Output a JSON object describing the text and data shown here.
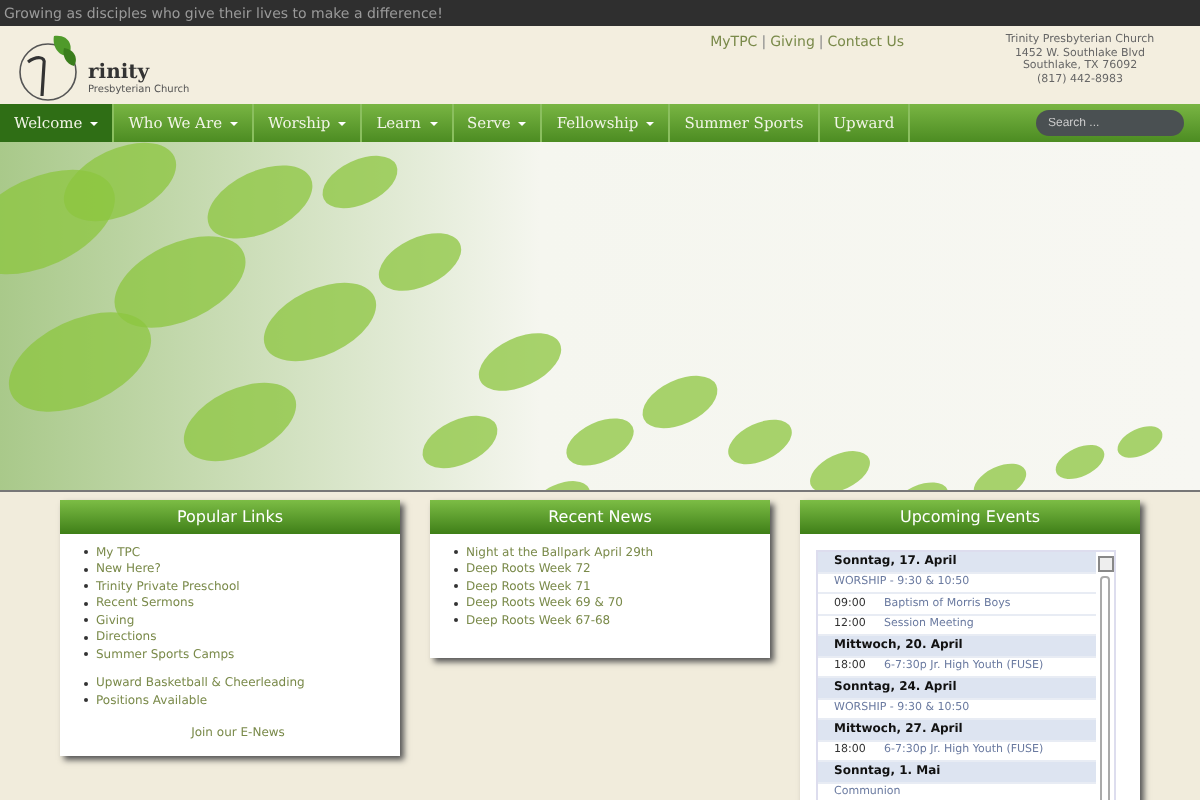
{
  "tagline": "Growing as disciples who give their lives to make a difference!",
  "logo": {
    "name": "rinity",
    "subtitle": "Presbyterian Church"
  },
  "top_links": {
    "items": [
      "MyTPC",
      "Giving",
      "Contact Us"
    ],
    "separator": "|"
  },
  "address": [
    "Trinity Presbyterian Church",
    "1452 W. Southlake Blvd",
    "Southlake, TX 76092",
    "(817) 442-8983"
  ],
  "nav": [
    {
      "label": "Welcome",
      "dropdown": true,
      "selected": true
    },
    {
      "label": "Who We Are",
      "dropdown": true,
      "selected": false
    },
    {
      "label": "Worship",
      "dropdown": true,
      "selected": false
    },
    {
      "label": "Learn",
      "dropdown": true,
      "selected": false
    },
    {
      "label": "Serve",
      "dropdown": true,
      "selected": false
    },
    {
      "label": "Fellowship",
      "dropdown": true,
      "selected": false
    },
    {
      "label": "Summer Sports",
      "dropdown": false,
      "selected": false
    },
    {
      "label": "Upward",
      "dropdown": false,
      "selected": false
    }
  ],
  "search": {
    "placeholder": "Search ..."
  },
  "popular_links": {
    "title": "Popular Links",
    "groups": [
      [
        "My TPC",
        "New Here?",
        "Trinity Private Preschool",
        "Recent Sermons",
        "Giving",
        "Directions",
        "Summer Sports Camps"
      ],
      [
        "Upward Basketball & Cheerleading",
        "Positions Available"
      ]
    ],
    "footer_link": "Join our E-News"
  },
  "recent_news": {
    "title": "Recent News",
    "items": [
      "Night at the Ballpark April 29th",
      "Deep Roots Week 72",
      "Deep Roots Week 71",
      "Deep Roots Week 69 & 70",
      "Deep Roots Week 67-68"
    ]
  },
  "upcoming_events": {
    "title": "Upcoming Events",
    "rows": [
      {
        "kind": "day",
        "text": "Sonntag, 17. April"
      },
      {
        "kind": "allday",
        "text": "WORSHIP - 9:30 & 10:50"
      },
      {
        "kind": "timed",
        "time": "09:00",
        "text": "Baptism of Morris Boys"
      },
      {
        "kind": "timed",
        "time": "12:00",
        "text": "Session Meeting"
      },
      {
        "kind": "day",
        "text": "Mittwoch, 20. April"
      },
      {
        "kind": "timed",
        "time": "18:00",
        "text": "6-7:30p Jr. High Youth (FUSE)"
      },
      {
        "kind": "day",
        "text": "Sonntag, 24. April"
      },
      {
        "kind": "allday",
        "text": "WORSHIP - 9:30 & 10:50"
      },
      {
        "kind": "day",
        "text": "Mittwoch, 27. April"
      },
      {
        "kind": "timed",
        "time": "18:00",
        "text": "6-7:30p Jr. High Youth (FUSE)"
      },
      {
        "kind": "day",
        "text": "Sonntag, 1. Mai"
      },
      {
        "kind": "allday",
        "text": "Communion"
      }
    ]
  }
}
